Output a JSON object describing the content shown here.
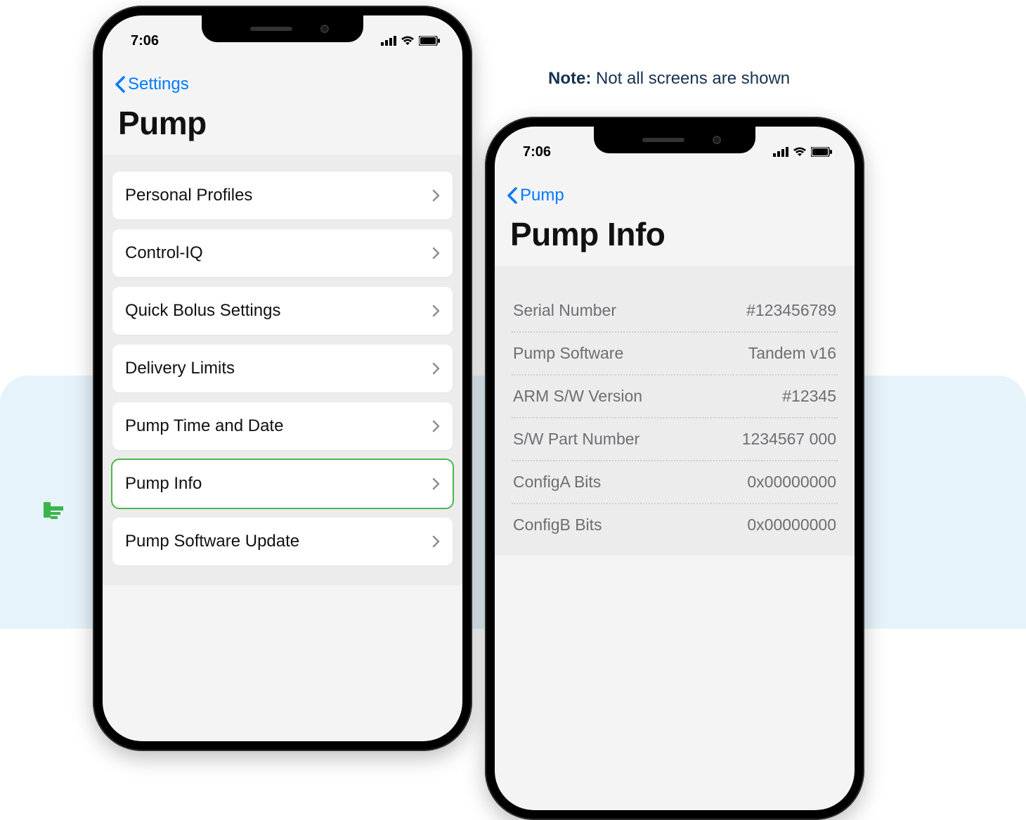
{
  "note": {
    "label": "Note:",
    "text": "Not all screens are shown"
  },
  "phone1": {
    "time": "7:06",
    "back_label": "Settings",
    "title": "Pump",
    "items": [
      {
        "label": "Personal Profiles",
        "highlight": false
      },
      {
        "label": "Control-IQ",
        "highlight": false
      },
      {
        "label": "Quick Bolus Settings",
        "highlight": false
      },
      {
        "label": "Delivery Limits",
        "highlight": false
      },
      {
        "label": "Pump Time and Date",
        "highlight": false
      },
      {
        "label": "Pump Info",
        "highlight": true
      },
      {
        "label": "Pump Software Update",
        "highlight": false
      }
    ]
  },
  "phone2": {
    "time": "7:06",
    "back_label": "Pump",
    "title": "Pump Info",
    "rows": [
      {
        "label": "Serial Number",
        "value": "#123456789"
      },
      {
        "label": "Pump Software",
        "value": "Tandem v16"
      },
      {
        "label": "ARM S/W Version",
        "value": "#12345"
      },
      {
        "label": "S/W Part Number",
        "value": "1234567 000"
      },
      {
        "label": "ConfigA Bits",
        "value": "0x00000000"
      },
      {
        "label": "ConfigB Bits",
        "value": "0x00000000"
      }
    ]
  }
}
